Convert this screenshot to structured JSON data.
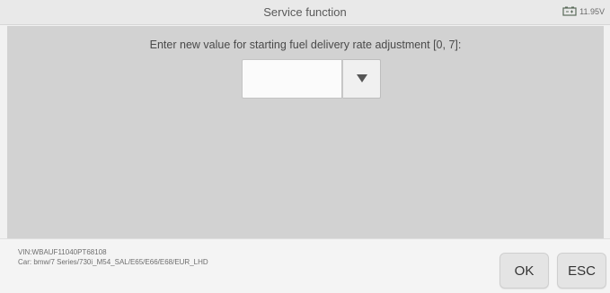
{
  "header": {
    "title": "Service function",
    "battery_icon": "battery-icon",
    "voltage": "11.95V"
  },
  "main": {
    "prompt": "Enter new value for starting fuel delivery rate adjustment [0, 7]:",
    "input": {
      "value": "",
      "dropdown_icon": "triangle-down-icon"
    }
  },
  "footer": {
    "vin": "VIN:WBAUF11040PT68108",
    "car": "Car: bmw/7 Series/730i_M54_SAL/E65/E66/E68/EUR_LHD",
    "ok_label": "OK",
    "esc_label": "ESC"
  },
  "colors": {
    "content_background": "#d2d2d2",
    "header_background": "#e9e9e9",
    "button_background": "#e4e4e4"
  }
}
